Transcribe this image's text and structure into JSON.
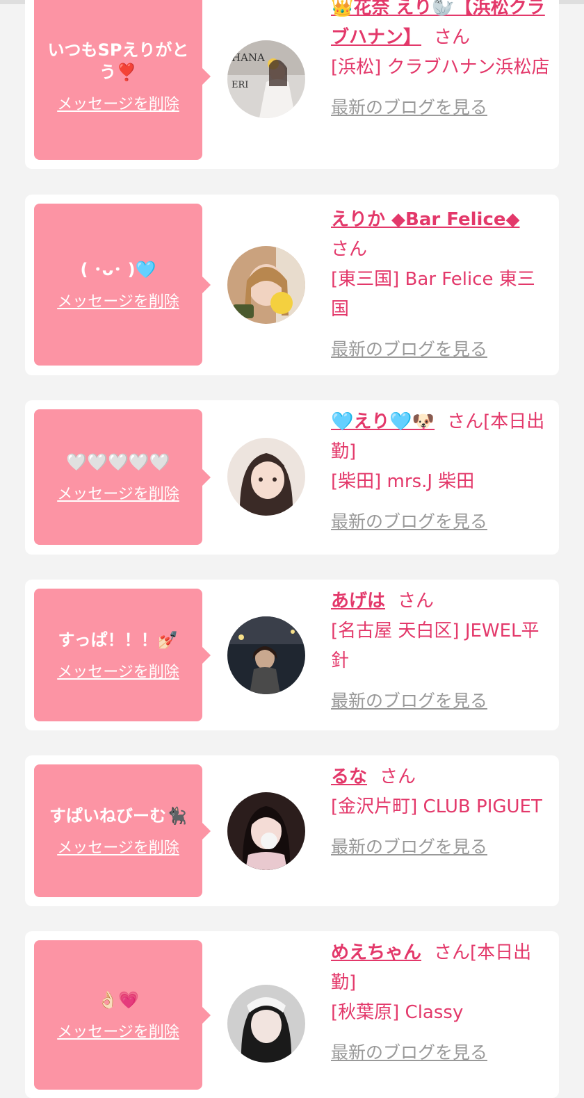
{
  "colors": {
    "accent": "#e3386a",
    "bubble": "#fc94a4",
    "link_gray": "#999999",
    "background": "#f3f3f3"
  },
  "messages": [
    {
      "message": "いつもSPえりがとう❣️",
      "delete_label": "メッセージを削除",
      "name": "👑花奈 えり🦭【浜松クラブハナン】",
      "san": "さん",
      "shop": "[浜松] クラブハナン浜松店",
      "blog_label": "最新のブログを見る",
      "avatar_icon": "profile-photo"
    },
    {
      "message": "( ･ᴗ･ )🩵",
      "delete_label": "メッセージを削除",
      "name": "えりか ◆Bar Felice◆",
      "san": "さん",
      "shop": "[東三国] Bar Felice 東三国",
      "blog_label": "最新のブログを見る",
      "avatar_icon": "profile-photo"
    },
    {
      "message": "🤍🤍🤍🤍🤍",
      "delete_label": "メッセージを削除",
      "name": "🩵えり🩵🐶",
      "san": "さん[本日出勤]",
      "shop": "[柴田] mrs.J 柴田",
      "blog_label": "最新のブログを見る",
      "avatar_icon": "profile-photo"
    },
    {
      "message": "すっぱ！！！💅🏻",
      "delete_label": "メッセージを削除",
      "name": "あげは",
      "san": "さん",
      "shop": "[名古屋 天白区] JEWEL平針",
      "blog_label": "最新のブログを見る",
      "avatar_icon": "profile-photo"
    },
    {
      "message": "すぱいねびーむ🐈‍⬛",
      "delete_label": "メッセージを削除",
      "name": "るな",
      "san": "さん",
      "shop": "[金沢片町] CLUB PIGUET",
      "blog_label": "最新のブログを見る",
      "avatar_icon": "profile-photo"
    },
    {
      "message": "👌🏻💗",
      "delete_label": "メッセージを削除",
      "name": "めえちゃん",
      "san": "さん[本日出勤]",
      "shop": "[秋葉原] Classy",
      "blog_label": "最新のブログを見る",
      "avatar_icon": "profile-photo"
    }
  ]
}
